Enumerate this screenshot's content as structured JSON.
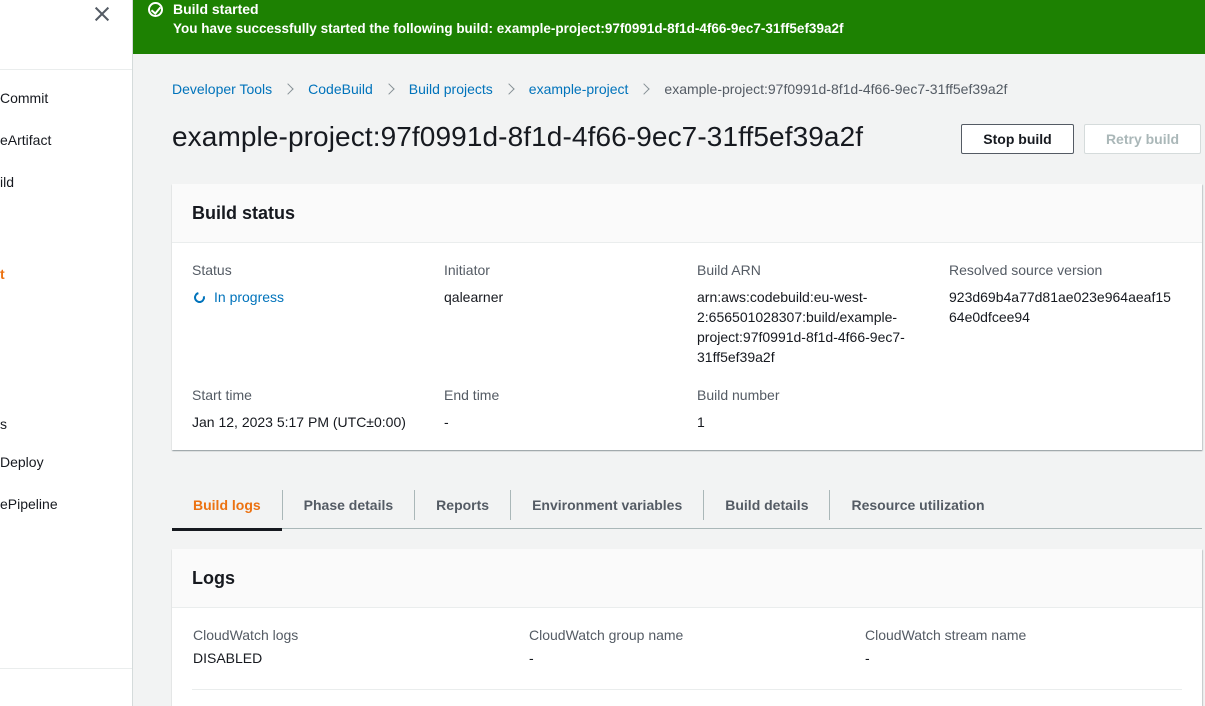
{
  "sidebar": {
    "items": [
      {
        "label": "Commit",
        "active": false
      },
      {
        "label": "eArtifact",
        "active": false
      },
      {
        "label": "ild",
        "active": false
      },
      {
        "label": "t",
        "active": true
      },
      {
        "label": "s",
        "active": false
      },
      {
        "label": "Deploy",
        "active": false
      },
      {
        "label": "ePipeline",
        "active": false
      }
    ]
  },
  "flash": {
    "title": "Build started",
    "message": "You have successfully started the following build: example-project:97f0991d-8f1d-4f66-9ec7-31ff5ef39a2f",
    "color": "#1d8102"
  },
  "breadcrumb": {
    "items": [
      "Developer Tools",
      "CodeBuild",
      "Build projects",
      "example-project"
    ],
    "current": "example-project:97f0991d-8f1d-4f66-9ec7-31ff5ef39a2f"
  },
  "page": {
    "title": "example-project:97f0991d-8f1d-4f66-9ec7-31ff5ef39a2f",
    "stop_label": "Stop build",
    "retry_label": "Retry build"
  },
  "build_status": {
    "header": "Build status",
    "status_label": "Status",
    "status_value": "In progress",
    "initiator_label": "Initiator",
    "initiator_value": "qalearner",
    "arn_label": "Build ARN",
    "arn_line1": "arn:aws:codebuild:eu-west-",
    "arn_line2": "2:656501028307:build/example-",
    "arn_line3": "project:97f0991d-8f1d-4f66-9ec7-",
    "arn_line4": "31ff5ef39a2f",
    "source_label": "Resolved source version",
    "source_line1": "923d69b4a77d81ae023e964aeaf15",
    "source_line2": "64e0dfcee94",
    "start_label": "Start time",
    "start_value": "Jan 12, 2023 5:17 PM (UTC±0:00)",
    "end_label": "End time",
    "end_value": "-",
    "number_label": "Build number",
    "number_value": "1"
  },
  "tabs": [
    "Build logs",
    "Phase details",
    "Reports",
    "Environment variables",
    "Build details",
    "Resource utilization"
  ],
  "logs": {
    "header": "Logs",
    "cw_logs_label": "CloudWatch logs",
    "cw_logs_value": "DISABLED",
    "group_label": "CloudWatch group name",
    "group_value": "-",
    "stream_label": "CloudWatch stream name",
    "stream_value": "-"
  },
  "colors": {
    "accent": "#ec7211",
    "link": "#0073bb",
    "success": "#1d8102"
  }
}
